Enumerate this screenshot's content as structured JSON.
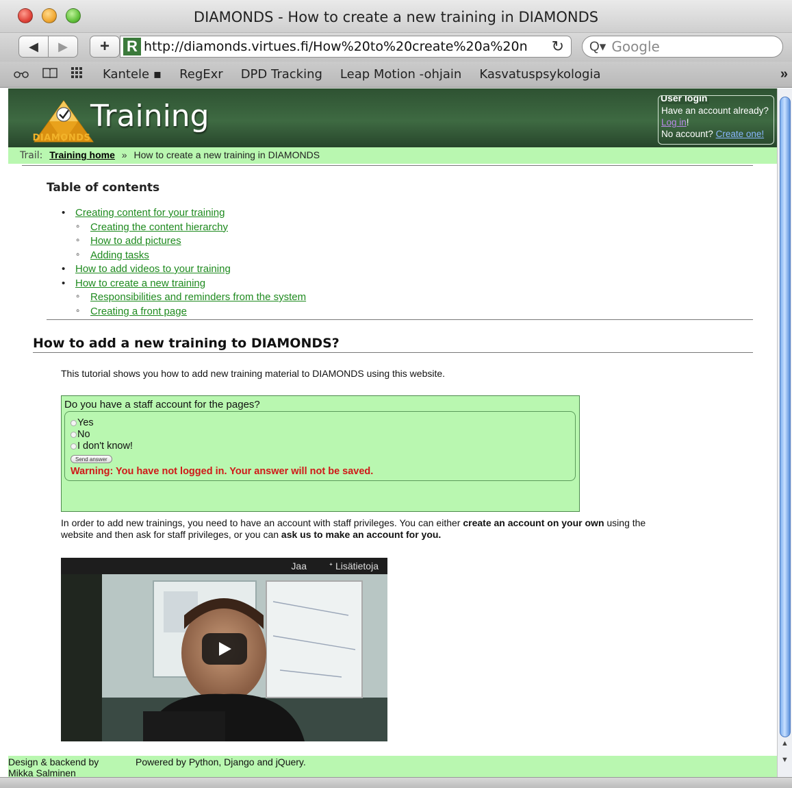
{
  "window": {
    "title": "DIAMONDS - How to create a new training in DIAMONDS"
  },
  "toolbar": {
    "back_icon": "◀",
    "forward_icon": "▶",
    "add_icon": "+",
    "site_icon_letter": "R",
    "url": "http://diamonds.virtues.fi/How%20to%20create%20a%20n",
    "reload_icon": "↻",
    "search_placeholder": "Google",
    "search_icon": "Q▾"
  },
  "bookmarks": {
    "items": [
      "Kantele ▪",
      "RegExr",
      "DPD Tracking",
      "Leap Motion -ohjain",
      "Kasvatuspsykologia"
    ],
    "more": "»"
  },
  "header": {
    "logo_word": "DIAMONDS",
    "site_title": "Training",
    "login": {
      "legend": "User login",
      "line1": "Have an account already?",
      "login_link": "Log in",
      "after_login": "!",
      "line2": "No account?",
      "create_link": "Create one!"
    }
  },
  "trail": {
    "label": "Trail:",
    "home": "Training home",
    "separator": "»",
    "current": "How to create a new training in DIAMONDS"
  },
  "toc": {
    "title": "Table of contents",
    "items": [
      {
        "level": 1,
        "label": "Creating content for your training"
      },
      {
        "level": 2,
        "label": "Creating the content hierarchy"
      },
      {
        "level": 2,
        "label": "How to add pictures"
      },
      {
        "level": 2,
        "label": "Adding tasks"
      },
      {
        "level": 1,
        "label": "How to add videos to your training"
      },
      {
        "level": 1,
        "label": "How to create a new training"
      },
      {
        "level": 2,
        "label": "Responsibilities and reminders from the system"
      },
      {
        "level": 2,
        "label": "Creating a front page"
      }
    ]
  },
  "section": {
    "title": "How to add a new training to DIAMONDS?",
    "intro": "This tutorial shows you how to add new training material to DIAMONDS using this website."
  },
  "poll": {
    "question": "Do you have a staff account for the pages?",
    "options": [
      "Yes",
      "No",
      "I don't know!"
    ],
    "send_label": "Send answer",
    "warning": "Warning: You have not logged in. Your answer will not be saved."
  },
  "body": {
    "part1": "In order to add new trainings, you need to have an account with staff privileges. You can either ",
    "bold1": "create an account on your own",
    "part2": " using the website and then ask for staff privileges, or you can ",
    "bold2": "ask us to make an account for you."
  },
  "video": {
    "share": "Jaa",
    "info": "ᐩ Lisätietoja"
  },
  "footer": {
    "design": "Design & backend by Mikka Salminen",
    "powered": "Powered by Python, Django and jQuery."
  },
  "colors": {
    "header_green": "#2e5232",
    "accent_light_green": "#b9f7b0",
    "link_green": "#1e8a1e",
    "warning_red": "#d01818",
    "logo_gold": "#f2b32a"
  }
}
